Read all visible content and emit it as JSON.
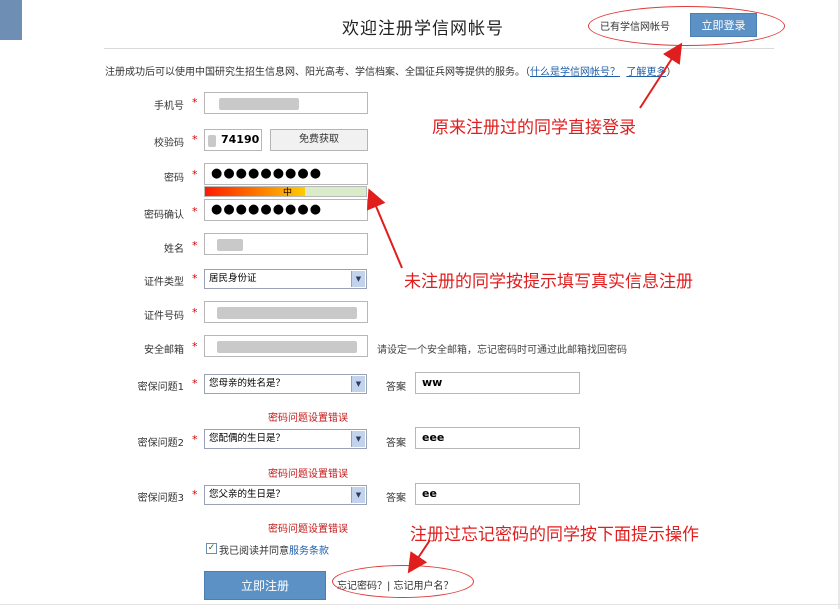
{
  "header": {
    "title": "欢迎注册学信网帐号",
    "has_account_text": "已有学信网帐号",
    "login_button": "立即登录"
  },
  "notice": {
    "text": "注册成功后可以使用中国研究生招生信息网、阳光高考、学信档案、全国征兵网等提供的服务。（",
    "link_what": "什么是学信网帐号？",
    "link_more": "了解更多",
    "close": "）"
  },
  "form": {
    "phone": {
      "label": "手机号"
    },
    "captcha": {
      "label": "校验码",
      "value": "74190",
      "button": "免费获取"
    },
    "password": {
      "label": "密码",
      "value": "●●●●●●●●●",
      "strength_label": "中",
      "strength_level": 0.62
    },
    "password_confirm": {
      "label": "密码确认",
      "value": "●●●●●●●●●"
    },
    "name": {
      "label": "姓名"
    },
    "id_type": {
      "label": "证件类型",
      "selected": "居民身份证"
    },
    "id_number": {
      "label": "证件号码"
    },
    "email": {
      "label": "安全邮箱",
      "hint": "请设定一个安全邮箱，忘记密码时可通过此邮箱找回密码"
    },
    "security_q1": {
      "label": "密保问题1",
      "selected": "您母亲的姓名是？",
      "answer_label": "答案",
      "answer": "ww",
      "error": "密码问题设置错误"
    },
    "security_q2": {
      "label": "密保问题2",
      "selected": "您配偶的生日是？",
      "answer_label": "答案",
      "answer": "eee",
      "error": "密码问题设置错误"
    },
    "security_q3": {
      "label": "密保问题3",
      "selected": "您父亲的生日是？",
      "answer_label": "答案",
      "answer": "ee",
      "error": "密码问题设置错误"
    },
    "agree_text": "我已阅读并同意",
    "agree_link": "服务条款",
    "register_button": "立即注册",
    "forgot_text": "忘记密码？| 忘记用户名？"
  },
  "annotations": {
    "login_note": "原来注册过的同学直接登录",
    "register_note": "未注册的同学按提示填写真实信息注册",
    "forgot_note": "注册过忘记密码的同学按下面提示操作"
  },
  "colors": {
    "primary_button": "#5c91c6",
    "annotation_red": "#e01e1e",
    "error_red": "#c41818"
  }
}
